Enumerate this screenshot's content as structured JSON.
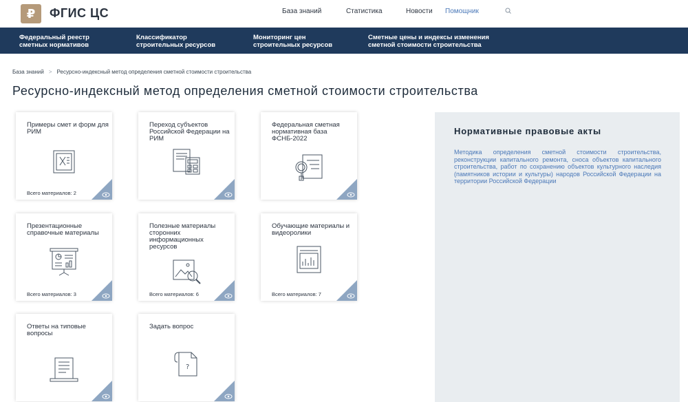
{
  "header": {
    "logo_symbol": "₽",
    "logo_text": "ФГИС ЦС",
    "nav": [
      {
        "label": "База знаний"
      },
      {
        "label": "Статистика"
      },
      {
        "label": "Новости"
      },
      {
        "label": "Помощник"
      }
    ],
    "search_icon": "search-icon"
  },
  "main_nav": [
    {
      "line1": "Федеральный реестр",
      "line2": "сметных нормативов"
    },
    {
      "line1": "Классификатор",
      "line2": "строительных ресурсов"
    },
    {
      "line1": "Мониторинг цен",
      "line2": "строительных ресурсов"
    },
    {
      "line1": "Сметные цены и индексы изменения",
      "line2": "сметной стоимости строительства"
    }
  ],
  "breadcrumb": {
    "home": "База знаний",
    "current": "Ресурсно-индексный метод определения сметной стоимости строительства"
  },
  "page_title": "Ресурсно-индексный метод определения сметной стоимости строительства",
  "cards": [
    {
      "title": "Примеры смет и форм для РИМ",
      "count": "Всего материалов: 2",
      "icon": "document-x-icon"
    },
    {
      "title": "Переход субъектов Российской Федерации на РИМ",
      "count": "",
      "icon": "documents-calculator-icon"
    },
    {
      "title": "Федеральная сметная нормативная база ФСНБ-2022",
      "count": "",
      "icon": "document-magnifier-icon"
    },
    {
      "title": "Презентационные справочные материалы",
      "count": "Всего материалов: 3",
      "icon": "presentation-board-icon"
    },
    {
      "title": "Полезные материалы сторонних информационных ресурсов",
      "count": "Всего материалов: 6",
      "icon": "image-search-icon"
    },
    {
      "title": "Обучающие материалы и видеоролики",
      "count": "Всего материалов: 7",
      "icon": "video-chart-icon"
    },
    {
      "title": "Ответы на типовые вопросы",
      "count": "",
      "icon": "laptop-document-icon"
    },
    {
      "title": "Задать вопрос",
      "count": "",
      "icon": "question-document-icon"
    }
  ],
  "panel": {
    "title": "Нормативные правовые акты",
    "link": "Методика определения сметной стоимости строительства, реконструкции капитального ремонта, сноса объектов капитального строительства, работ по сохранению объектов культурного наследия (памятников истории и культуры) народов Российской Федерации на территории Российской Федерации"
  },
  "colors": {
    "nav_bg": "#1f3a5c",
    "accent_link": "#4a78b8",
    "logo": "#b59a7a",
    "card_corner": "#8ea6c2",
    "panel_bg": "#e9edf0"
  }
}
